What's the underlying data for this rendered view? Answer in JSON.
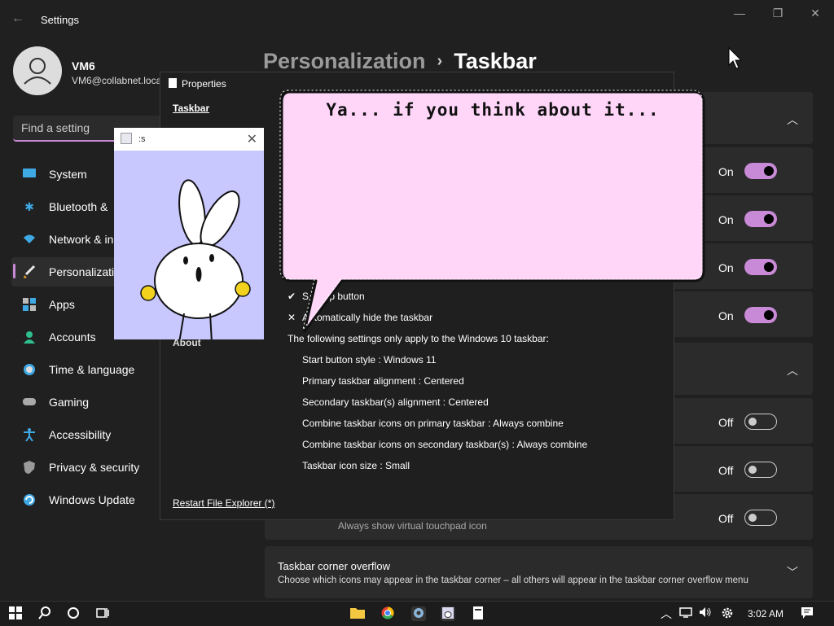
{
  "window": {
    "title": "Settings"
  },
  "user": {
    "name": "VM6",
    "email": "VM6@collabnet.loca"
  },
  "search": {
    "placeholder": "Find a setting"
  },
  "nav": [
    {
      "label": "System",
      "icon": "system-icon"
    },
    {
      "label": "Bluetooth &",
      "icon": "bluetooth-icon"
    },
    {
      "label": "Network & in",
      "icon": "wifi-icon"
    },
    {
      "label": "Personalizatio",
      "icon": "brush-icon",
      "active": true
    },
    {
      "label": "Apps",
      "icon": "apps-icon"
    },
    {
      "label": "Accounts",
      "icon": "person-icon"
    },
    {
      "label": "Time & language",
      "icon": "globe-clock-icon"
    },
    {
      "label": "Gaming",
      "icon": "gamepad-icon"
    },
    {
      "label": "Accessibility",
      "icon": "accessibility-icon"
    },
    {
      "label": "Privacy & security",
      "icon": "shield-icon"
    },
    {
      "label": "Windows Update",
      "icon": "update-icon"
    }
  ],
  "breadcrumb": {
    "parent": "Personalization",
    "separator": "›",
    "current": "Taskbar"
  },
  "toggles": [
    {
      "state": "On",
      "on": true
    },
    {
      "state": "On",
      "on": true
    },
    {
      "state": "On",
      "on": true
    },
    {
      "state": "On",
      "on": true
    },
    {
      "state": "Off",
      "on": false
    },
    {
      "state": "Off",
      "on": false
    },
    {
      "state": "Off",
      "on": false
    }
  ],
  "partial_row": {
    "description": "Always show virtual touchpad icon"
  },
  "overflow": {
    "title": "Taskbar corner overflow",
    "description": "Choose which icons may appear in the taskbar corner – all others will appear in the taskbar corner overflow menu"
  },
  "properties": {
    "title": "Properties",
    "tab": "Taskbar",
    "about": "About",
    "check1": "✔",
    "check1_text": "S   sktop button",
    "check2": "✕",
    "check2_text": "Automatically hide the taskbar",
    "note": "The following settings only apply to the Windows 10 taskbar:",
    "settings": [
      "Start button style : Windows 11",
      "Primary taskbar alignment : Centered",
      "Secondary taskbar(s) alignment : Centered",
      "Combine taskbar icons on primary taskbar : Always combine",
      "Combine taskbar icons on secondary taskbar(s) : Always combine",
      "Taskbar icon size : Small"
    ],
    "restart": "Restart File Explorer (*)"
  },
  "bunny_window": {
    "title": ":s"
  },
  "bubble": {
    "text": "Ya... if you think about it..."
  },
  "taskbar": {
    "time": "3:02 AM"
  },
  "colors": {
    "accent": "#c889d6",
    "bubble_fill": "#ffd6f8",
    "bunny_bg": "#c8c8ff"
  }
}
